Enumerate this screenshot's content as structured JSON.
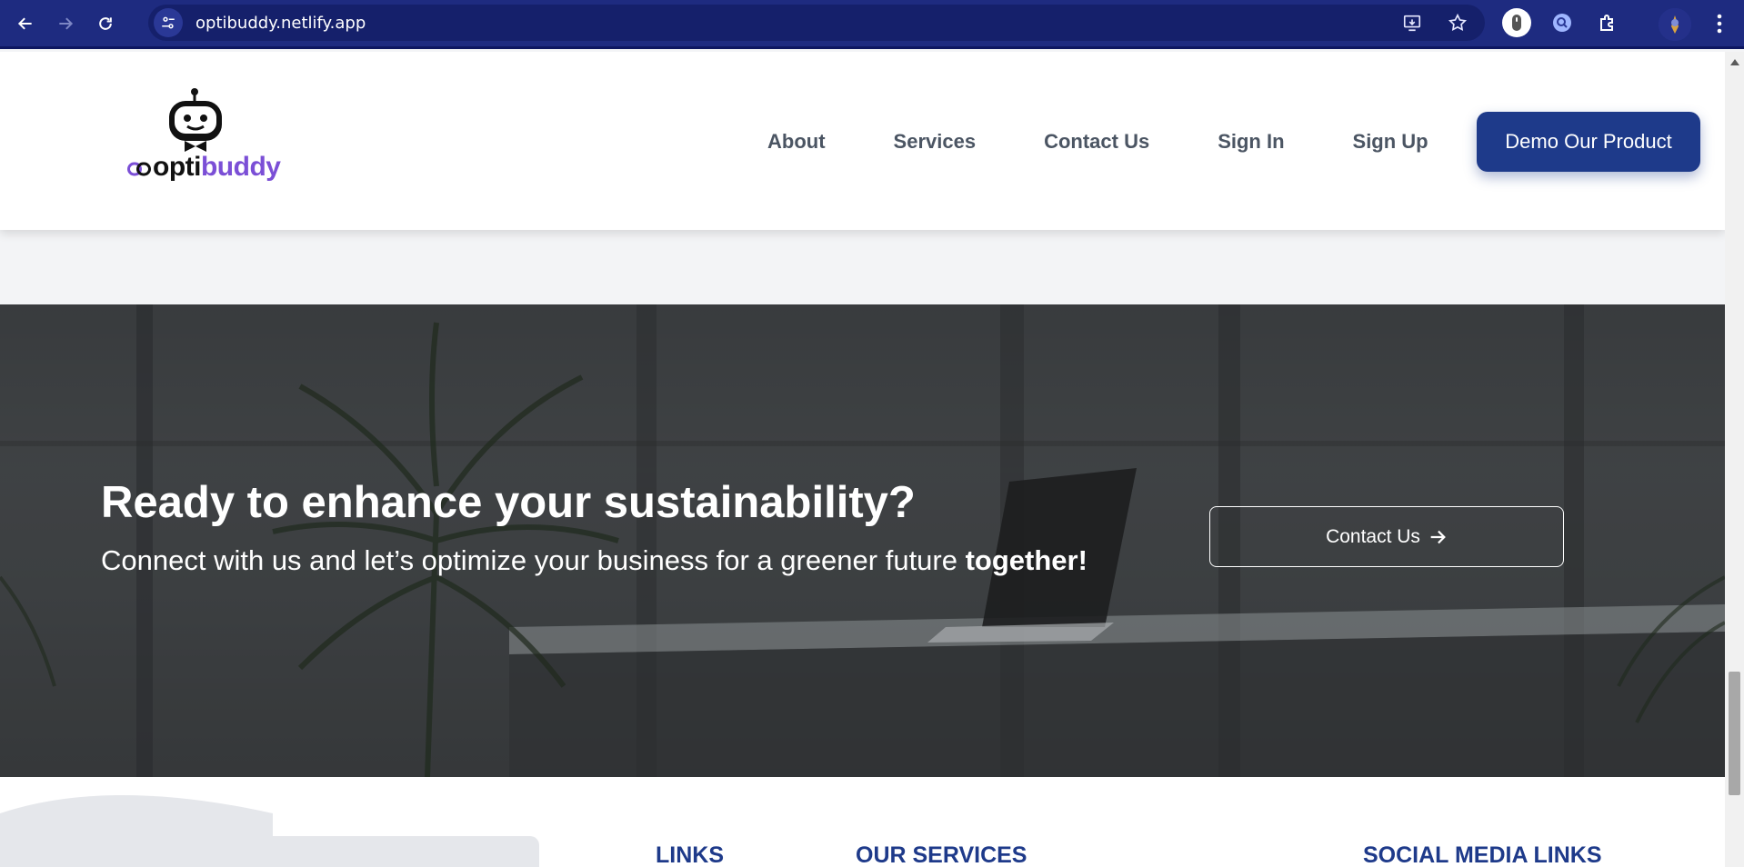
{
  "browser": {
    "url": "optibuddy.netlify.app"
  },
  "header": {
    "logo_prefix": "opti",
    "logo_suffix": "buddy",
    "nav": [
      "About",
      "Services",
      "Contact Us",
      "Sign In",
      "Sign Up"
    ],
    "demo_button": "Demo Our Product"
  },
  "cta": {
    "title": "Ready to enhance your sustainability?",
    "subtitle": "Connect with us and let’s optimize your business for a greener future ",
    "subtitle_emphasis": "together!",
    "contact_button": "Contact Us"
  },
  "footer": {
    "headings": [
      "LINKS",
      "OUR SERVICES",
      "SOCIAL MEDIA LINKS"
    ]
  },
  "colors": {
    "browser_bar": "#1e2b80",
    "brand_blue": "#1e3a8a",
    "brand_purple": "#7b4fd6",
    "nav_text": "#4b5563"
  }
}
